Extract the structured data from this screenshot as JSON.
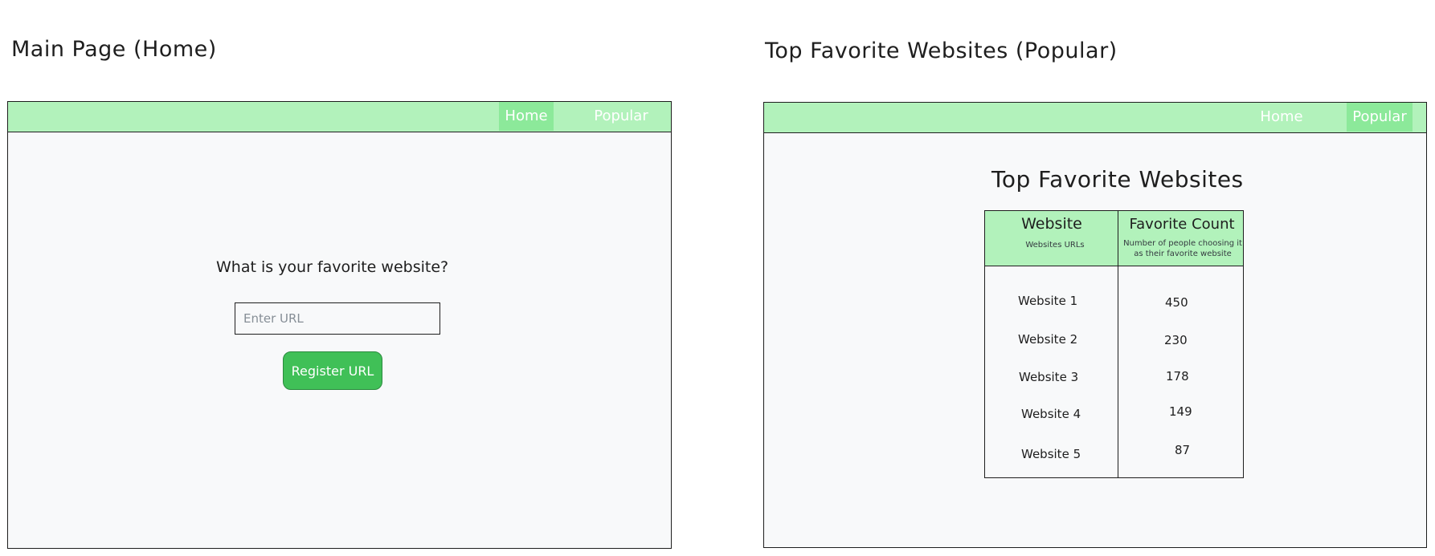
{
  "home": {
    "section_title": "Main Page (Home)",
    "nav": {
      "home_label": "Home",
      "popular_label": "Popular"
    },
    "question": "What is your favorite website?",
    "url_input": {
      "placeholder": "Enter URL",
      "value": ""
    },
    "register_button": "Register URL"
  },
  "popular": {
    "section_title": "Top Favorite Websites (Popular)",
    "nav": {
      "home_label": "Home",
      "popular_label": "Popular"
    },
    "heading": "Top Favorite Websites",
    "table": {
      "columns": [
        {
          "title": "Website",
          "subtitle": "Websites URLs"
        },
        {
          "title": "Favorite Count",
          "subtitle": "Number of people choosing it as their favorite website"
        }
      ],
      "rows": [
        {
          "website": "Website 1",
          "count": "450"
        },
        {
          "website": "Website 2",
          "count": "230"
        },
        {
          "website": "Website 3",
          "count": "178"
        },
        {
          "website": "Website 4",
          "count": "149"
        },
        {
          "website": "Website 5",
          "count": "87"
        }
      ]
    }
  },
  "colors": {
    "nav_background": "#b2f2bb",
    "nav_active": "#8ce99a",
    "button_green": "#40c057",
    "frame_background": "#f8f9fa"
  }
}
